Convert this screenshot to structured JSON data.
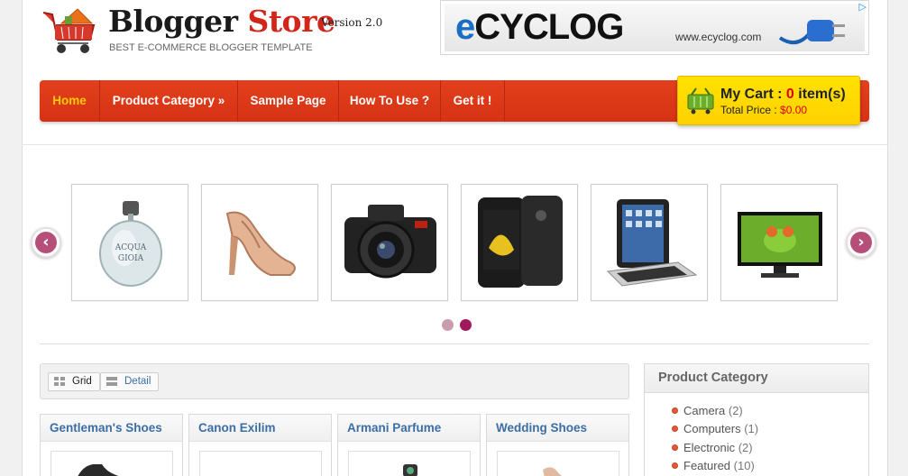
{
  "header": {
    "brand_main": "Blogger",
    "brand_accent": "Store",
    "version": "Version 2.0",
    "tagline": "BEST E-COMMERCE BLOGGER TEMPLATE"
  },
  "ad": {
    "logo_e": "e",
    "logo_rest": "CYCLOG",
    "url": "www.ecyclog.com",
    "choice_icon": "adchoices-icon"
  },
  "nav": {
    "items": [
      {
        "label": "Home",
        "active": true
      },
      {
        "label": "Product Category »",
        "active": false
      },
      {
        "label": "Sample Page",
        "active": false
      },
      {
        "label": "How To Use ?",
        "active": false
      },
      {
        "label": "Get it !",
        "active": false
      }
    ]
  },
  "cart": {
    "title_prefix": "My Cart : ",
    "count": "0",
    "title_suffix": " item(s)",
    "price_label": "Total Price : ",
    "price_value": "$0.00"
  },
  "slider": {
    "products": [
      "perfume",
      "high-heel-shoe",
      "dslr-camera",
      "smartphone",
      "tablet-keyboard",
      "monitor"
    ],
    "prev_icon": "chevron-left-icon",
    "next_icon": "chevron-right-icon",
    "dots": [
      {
        "active": false
      },
      {
        "active": true
      }
    ]
  },
  "view": {
    "grid_label": "Grid",
    "detail_label": "Detail"
  },
  "products": [
    {
      "title": "Gentleman's Shoes"
    },
    {
      "title": "Canon Exilim"
    },
    {
      "title": "Armani Parfume"
    },
    {
      "title": "Wedding Shoes"
    }
  ],
  "sidebar": {
    "title": "Product Category",
    "categories": [
      {
        "name": "Camera",
        "count": "(2)"
      },
      {
        "name": "Computers",
        "count": "(1)"
      },
      {
        "name": "Electronic",
        "count": "(2)"
      },
      {
        "name": "Featured",
        "count": "(10)"
      }
    ]
  },
  "colors": {
    "nav_red": "#d63215",
    "nav_active": "#ffcc00",
    "cart_yellow": "#ffd800",
    "link_blue": "#3c6ea6",
    "slider_arrow": "#b54f79"
  }
}
